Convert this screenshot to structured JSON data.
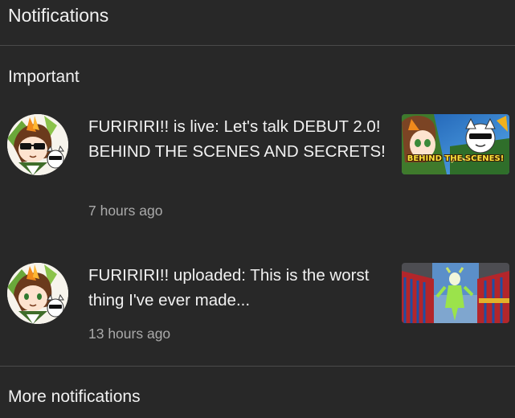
{
  "header": {
    "title": "Notifications"
  },
  "sections": {
    "important_title": "Important",
    "more_title": "More notifications"
  },
  "notifications": [
    {
      "text": "FURIRIRI!! is live: Let's talk DEBUT 2.0! BEHIND THE SCENES AND SECRETS!",
      "time": "7 hours ago",
      "thumb_caption": "BEHIND THE SCENES!"
    },
    {
      "text": "FURIRIRI!! uploaded: This is the worst thing I've ever made...",
      "time": "13 hours ago"
    }
  ],
  "icons": {
    "avatar": "channel-avatar-icon",
    "thumbnail": "video-thumbnail"
  },
  "colors": {
    "background": "#282828",
    "divider": "#4a4a4a",
    "text_primary": "#f1f1f1",
    "text_secondary": "#aaaaaa"
  }
}
